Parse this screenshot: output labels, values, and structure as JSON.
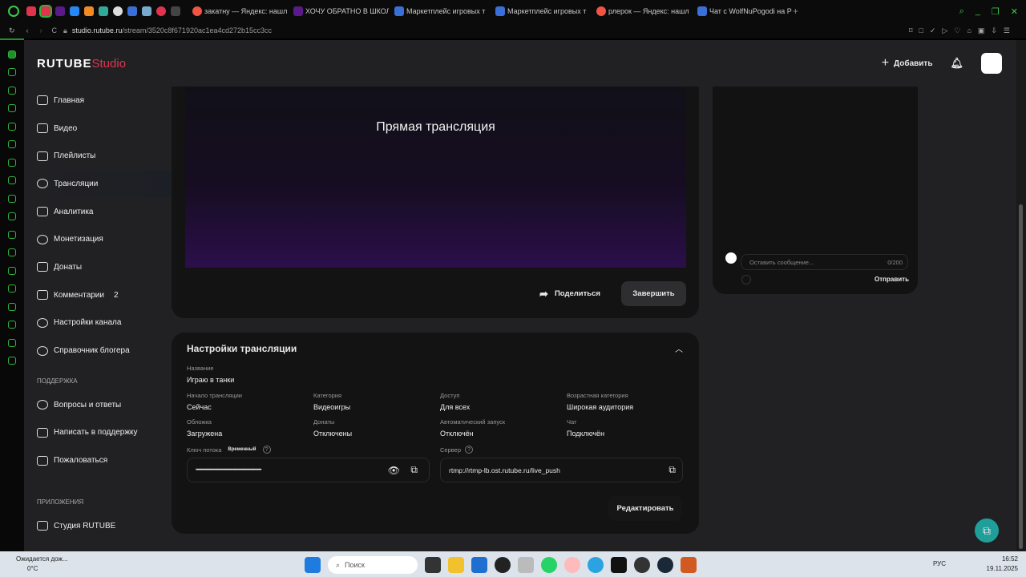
{
  "browser": {
    "tabs": [
      "закатну — Яндекс: нашл",
      "ХОЧУ ОБРАТНО В ШКОЛ",
      "Маркетплейс игровых т",
      "Маркетплейс игровых т",
      "рлерок — Яндекс: нашл",
      "Чат с WolfNuPogodi на P"
    ],
    "url_host": "studio.rutube.ru",
    "url_path": "/stream/3520c8f671920ac1ea4cd272b15cc3cc"
  },
  "header": {
    "logo": "RUTUBE",
    "logo_suffix": "Studio",
    "add_label": "Добавить"
  },
  "sidebar": {
    "items": [
      {
        "label": "Главная"
      },
      {
        "label": "Видео"
      },
      {
        "label": "Плейлисты"
      },
      {
        "label": "Трансляции"
      },
      {
        "label": "Аналитика"
      },
      {
        "label": "Монетизация"
      },
      {
        "label": "Донаты"
      },
      {
        "label": "Комментарии",
        "badge": "2"
      },
      {
        "label": "Настройки канала"
      },
      {
        "label": "Справочник блогера"
      }
    ],
    "support_title": "ПОДДЕРЖКА",
    "support": [
      {
        "label": "Вопросы и ответы"
      },
      {
        "label": "Написать в поддержку"
      },
      {
        "label": "Пожаловаться"
      }
    ],
    "apps_title": "ПРИЛОЖЕНИЯ",
    "apps": [
      {
        "label": "Студия RUTUBE"
      }
    ]
  },
  "player": {
    "title": "Прямая трансляция",
    "share_label": "Поделиться",
    "finish_label": "Завершить"
  },
  "chat": {
    "placeholder": "Оставить сообщение...",
    "counter": "0/200",
    "send_label": "Отправить"
  },
  "settings": {
    "title": "Настройки трансляции",
    "name_label": "Название",
    "name_value": "Играю в танки",
    "fields": [
      {
        "label": "Начало трансляции",
        "value": "Сейчас"
      },
      {
        "label": "Категория",
        "value": "Видеоигры"
      },
      {
        "label": "Доступ",
        "value": "Для всех"
      },
      {
        "label": "Возрастная категория",
        "value": "Широкая аудитория"
      },
      {
        "label": "Обложка",
        "value": "Загружена"
      },
      {
        "label": "Донаты",
        "value": "Отключены"
      },
      {
        "label": "Автоматический запуск",
        "value": "Отключён"
      },
      {
        "label": "Чат",
        "value": "Подключён"
      }
    ],
    "key_label": "Ключ потока",
    "key_tag": "Временный",
    "key_value": "••••••••••••••••••••••••••••••••••••••••••••••••••••••••••••••••••••••••••",
    "server_label": "Сервер",
    "server_value": "rtmp://rtmp-lb.ost.rutube.ru/live_push",
    "edit_label": "Редактировать"
  },
  "taskbar": {
    "weather": "Ожидается дож...",
    "temp": "0°C",
    "search": "Поиск",
    "lang": "РУС",
    "time": "16:52",
    "date": "19.11.2025"
  }
}
